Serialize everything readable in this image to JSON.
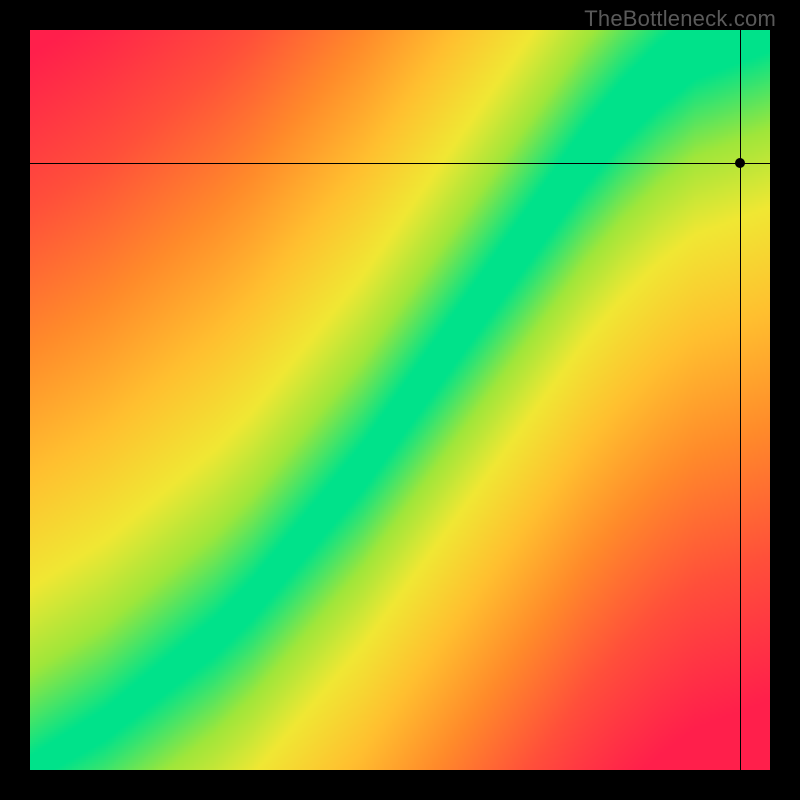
{
  "watermark": "TheBottleneck.com",
  "chart_data": {
    "type": "heatmap",
    "title": "",
    "xlabel": "",
    "ylabel": "",
    "xlim": [
      0,
      100
    ],
    "ylim": [
      0,
      100
    ],
    "note": "Axes have no visible tick labels. Values below are normalized 0–100 along each axis; the green ridge is the optimal-balance curve, color encodes distance from it.",
    "optimal_curve": {
      "x": [
        0,
        5,
        10,
        15,
        20,
        25,
        30,
        35,
        40,
        45,
        50,
        55,
        60,
        65,
        70,
        75,
        80,
        85,
        90,
        95,
        100
      ],
      "y": [
        0,
        3,
        6,
        10,
        14,
        18,
        23,
        29,
        35,
        41,
        48,
        55,
        62,
        69,
        76,
        83,
        89,
        94,
        98,
        100,
        102
      ]
    },
    "color_stops": [
      {
        "t": 0.0,
        "color": "#00e28a"
      },
      {
        "t": 0.12,
        "color": "#9fe63a"
      },
      {
        "t": 0.24,
        "color": "#f0e733"
      },
      {
        "t": 0.4,
        "color": "#ffbf2f"
      },
      {
        "t": 0.58,
        "color": "#ff8a2a"
      },
      {
        "t": 0.78,
        "color": "#ff4f3a"
      },
      {
        "t": 1.0,
        "color": "#ff1f4b"
      }
    ],
    "crosshair": {
      "x": 96,
      "y": 82
    },
    "marker": {
      "x": 96,
      "y": 82
    },
    "grid": false,
    "legend": null
  }
}
